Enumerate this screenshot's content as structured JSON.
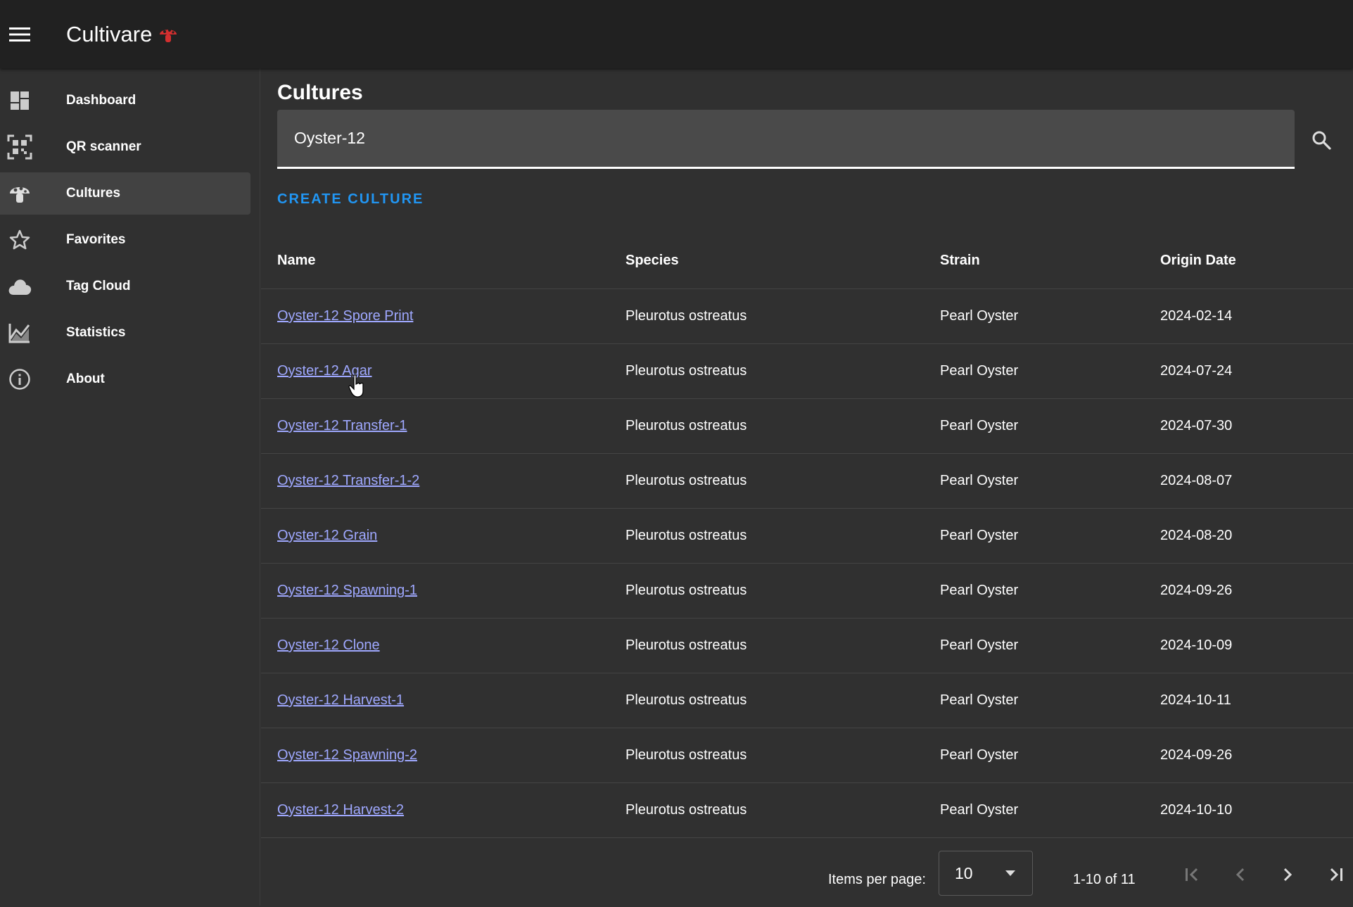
{
  "app": {
    "title": "Cultivare",
    "accent_color": "#d32f2f",
    "link_color": "#9fa8ff",
    "button_color": "#2196f3"
  },
  "sidebar": {
    "items": [
      {
        "label": "Dashboard",
        "icon": "dashboard-icon",
        "active": false
      },
      {
        "label": "QR scanner",
        "icon": "qr-scanner-icon",
        "active": false
      },
      {
        "label": "Cultures",
        "icon": "mushroom-icon",
        "active": true
      },
      {
        "label": "Favorites",
        "icon": "star-icon",
        "active": false
      },
      {
        "label": "Tag Cloud",
        "icon": "cloud-icon",
        "active": false
      },
      {
        "label": "Statistics",
        "icon": "chart-icon",
        "active": false
      },
      {
        "label": "About",
        "icon": "info-icon",
        "active": false
      }
    ]
  },
  "main": {
    "title": "Cultures",
    "search": {
      "value": "Oyster-12",
      "placeholder": ""
    },
    "create_button": "CREATE CULTURE",
    "table": {
      "columns": [
        "Name",
        "Species",
        "Strain",
        "Origin Date"
      ],
      "rows": [
        {
          "name": "Oyster-12 Spore Print",
          "species": "Pleurotus ostreatus",
          "strain": "Pearl Oyster",
          "date": "2024-02-14"
        },
        {
          "name": "Oyster-12 Agar",
          "species": "Pleurotus ostreatus",
          "strain": "Pearl Oyster",
          "date": "2024-07-24"
        },
        {
          "name": "Oyster-12 Transfer-1",
          "species": "Pleurotus ostreatus",
          "strain": "Pearl Oyster",
          "date": "2024-07-30"
        },
        {
          "name": "Oyster-12 Transfer-1-2",
          "species": "Pleurotus ostreatus",
          "strain": "Pearl Oyster",
          "date": "2024-08-07"
        },
        {
          "name": "Oyster-12 Grain",
          "species": "Pleurotus ostreatus",
          "strain": "Pearl Oyster",
          "date": "2024-08-20"
        },
        {
          "name": "Oyster-12 Spawning-1",
          "species": "Pleurotus ostreatus",
          "strain": "Pearl Oyster",
          "date": "2024-09-26"
        },
        {
          "name": "Oyster-12 Clone",
          "species": "Pleurotus ostreatus",
          "strain": "Pearl Oyster",
          "date": "2024-10-09"
        },
        {
          "name": "Oyster-12 Harvest-1",
          "species": "Pleurotus ostreatus",
          "strain": "Pearl Oyster",
          "date": "2024-10-11"
        },
        {
          "name": "Oyster-12 Spawning-2",
          "species": "Pleurotus ostreatus",
          "strain": "Pearl Oyster",
          "date": "2024-09-26"
        },
        {
          "name": "Oyster-12 Harvest-2",
          "species": "Pleurotus ostreatus",
          "strain": "Pearl Oyster",
          "date": "2024-10-10"
        }
      ]
    },
    "paginator": {
      "items_per_page_label": "Items per page:",
      "items_per_page_value": "10",
      "range_label": "1-10 of 11"
    }
  }
}
